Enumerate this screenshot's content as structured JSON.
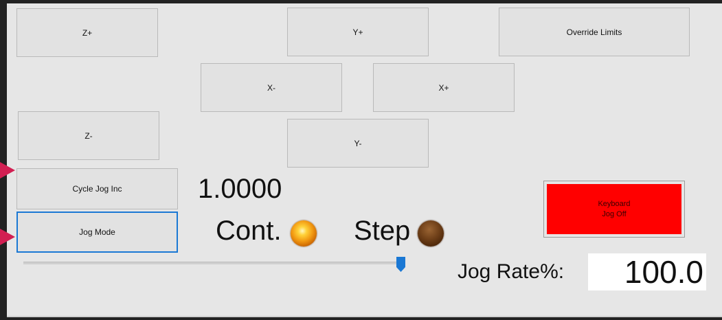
{
  "buttons": {
    "z_plus": "Z+",
    "y_plus": "Y+",
    "override_limits": "Override Limits",
    "x_minus": "X-",
    "x_plus": "X+",
    "z_minus": "Z-",
    "y_minus": "Y-",
    "cycle_jog_inc": "Cycle Jog Inc",
    "jog_mode": "Jog Mode",
    "keyboard_jog": "Keyboard\nJog Off"
  },
  "jog": {
    "increment": "1.0000",
    "cont_label": "Cont.",
    "step_label": "Step",
    "cont_active": true,
    "step_active": false,
    "rate_label": "Jog Rate%:",
    "rate_value": "100.0",
    "slider_level": 1.0
  },
  "colors": {
    "keyboard_jog_off": "#ff0000",
    "focus_border": "#1a78d4",
    "slider_thumb": "#1a78d4",
    "annotation_arrow": "#d21f52"
  },
  "icons": {
    "cont_led": "led-on-icon",
    "step_led": "led-off-icon"
  }
}
